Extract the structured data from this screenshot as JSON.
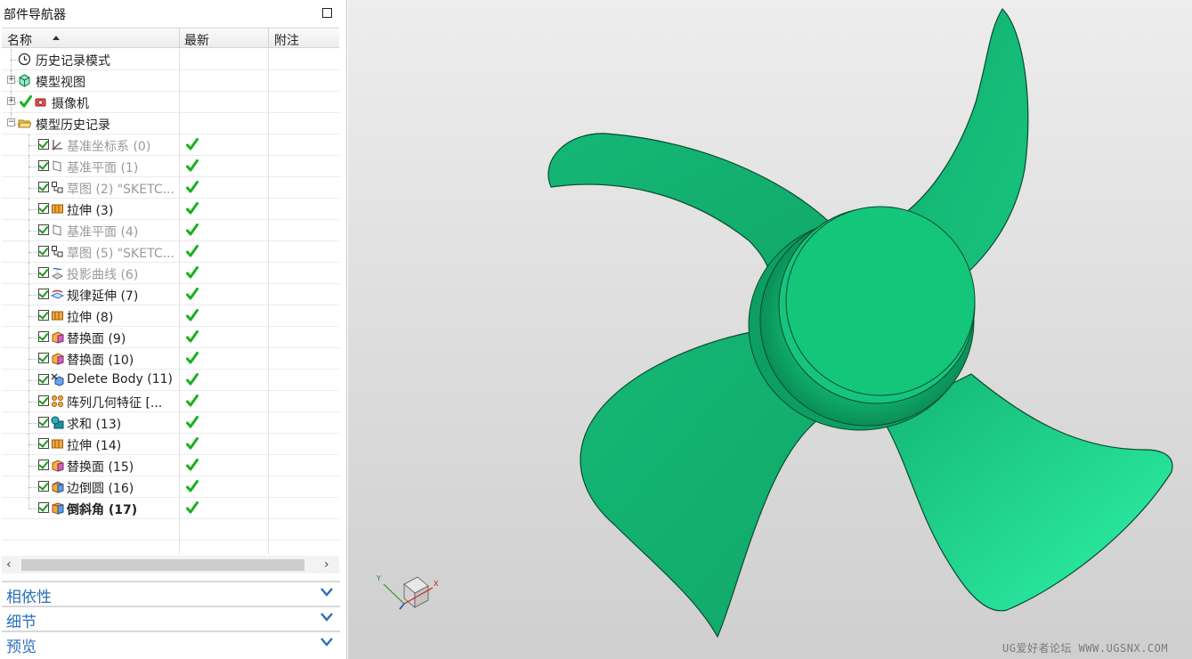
{
  "navigator": {
    "title": "部件导航器",
    "columns": {
      "name": "名称",
      "latest": "最新",
      "notes": "附注"
    },
    "top_nodes": [
      {
        "label": "历史记录模式",
        "icon": "clock-icon"
      },
      {
        "label": "模型视图",
        "icon": "model-view-icon",
        "expandable": true
      },
      {
        "label": "摄像机",
        "icon": "camera-icon",
        "expandable": true,
        "checked": true
      },
      {
        "label": "模型历史记录",
        "icon": "folder-open-icon",
        "expanded": true
      }
    ],
    "features": [
      {
        "label": "基准坐标系 (0)",
        "icon": "datum-csys-icon",
        "greyed": true,
        "latest": true
      },
      {
        "label": "基准平面 (1)",
        "icon": "datum-plane-icon",
        "greyed": true,
        "latest": true
      },
      {
        "label": "草图 (2) \"SKETC...",
        "icon": "sketch-icon",
        "greyed": true,
        "latest": true
      },
      {
        "label": "拉伸 (3)",
        "icon": "extrude-icon",
        "greyed": false,
        "latest": true
      },
      {
        "label": "基准平面 (4)",
        "icon": "datum-plane-icon",
        "greyed": true,
        "latest": true
      },
      {
        "label": "草图 (5) \"SKETC...",
        "icon": "sketch-icon",
        "greyed": true,
        "latest": true
      },
      {
        "label": "投影曲线 (6)",
        "icon": "project-curve-icon",
        "greyed": true,
        "latest": true
      },
      {
        "label": "规律延伸 (7)",
        "icon": "law-extension-icon",
        "greyed": false,
        "latest": true
      },
      {
        "label": "拉伸 (8)",
        "icon": "extrude-icon",
        "greyed": false,
        "latest": true
      },
      {
        "label": "替换面 (9)",
        "icon": "replace-face-icon",
        "greyed": false,
        "latest": true
      },
      {
        "label": "替换面 (10)",
        "icon": "replace-face-icon",
        "greyed": false,
        "latest": true
      },
      {
        "label": "Delete Body (11)",
        "icon": "delete-body-icon",
        "greyed": false,
        "latest": true
      },
      {
        "label": "阵列几何特征 [...",
        "icon": "pattern-geometry-icon",
        "greyed": false,
        "latest": true
      },
      {
        "label": "求和 (13)",
        "icon": "unite-icon",
        "greyed": false,
        "latest": true
      },
      {
        "label": "拉伸 (14)",
        "icon": "extrude-icon",
        "greyed": false,
        "latest": true
      },
      {
        "label": "替换面 (15)",
        "icon": "replace-face-icon",
        "greyed": false,
        "latest": true
      },
      {
        "label": "边倒圆 (16)",
        "icon": "edge-blend-icon",
        "greyed": false,
        "latest": true
      },
      {
        "label": "倒斜角 (17)",
        "icon": "chamfer-icon",
        "greyed": false,
        "latest": true,
        "current": true
      }
    ],
    "sections": [
      {
        "label": "相依性"
      },
      {
        "label": "细节"
      },
      {
        "label": "预览"
      }
    ]
  },
  "viewport": {
    "model_color": "#14c77e",
    "triad": {
      "x": "X",
      "y": "Y"
    },
    "watermark": "UG爱好者论坛 WWW.UGSNX.COM"
  }
}
